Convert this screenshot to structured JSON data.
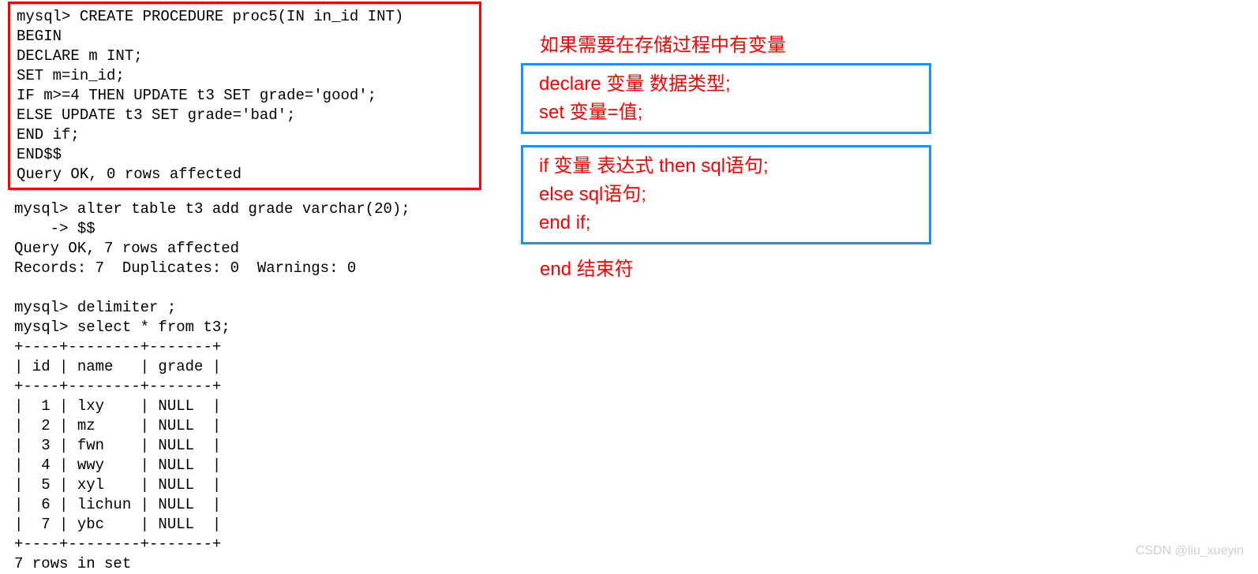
{
  "terminal": {
    "block1": "mysql> CREATE PROCEDURE proc5(IN in_id INT)\nBEGIN\nDECLARE m INT;\nSET m=in_id;\nIF m>=4 THEN UPDATE t3 SET grade='good';\nELSE UPDATE t3 SET grade='bad';\nEND if;\nEND$$\nQuery OK, 0 rows affected",
    "block2": "mysql> alter table t3 add grade varchar(20);\n    -> $$\nQuery OK, 7 rows affected\nRecords: 7  Duplicates: 0  Warnings: 0\n\nmysql> delimiter ;\nmysql> select * from t3;\n+----+--------+-------+\n| id | name   | grade |\n+----+--------+-------+\n|  1 | lxy    | NULL  |\n|  2 | mz     | NULL  |\n|  3 | fwn    | NULL  |\n|  4 | wwy    | NULL  |\n|  5 | xyl    | NULL  |\n|  6 | lichun | NULL  |\n|  7 | ybc    | NULL  |\n+----+--------+-------+\n7 rows in set"
  },
  "annotations": {
    "heading": "如果需要在存储过程中有变量",
    "box1_line1": "declare 变量 数据类型;",
    "box1_line2": "set 变量=值;",
    "box2_line1": "if 变量 表达式 then sql语句;",
    "box2_line2": "else sql语句;",
    "box2_line3": "end if;",
    "after_box2": "end 结束符"
  },
  "watermark": "CSDN @liu_xueyin"
}
